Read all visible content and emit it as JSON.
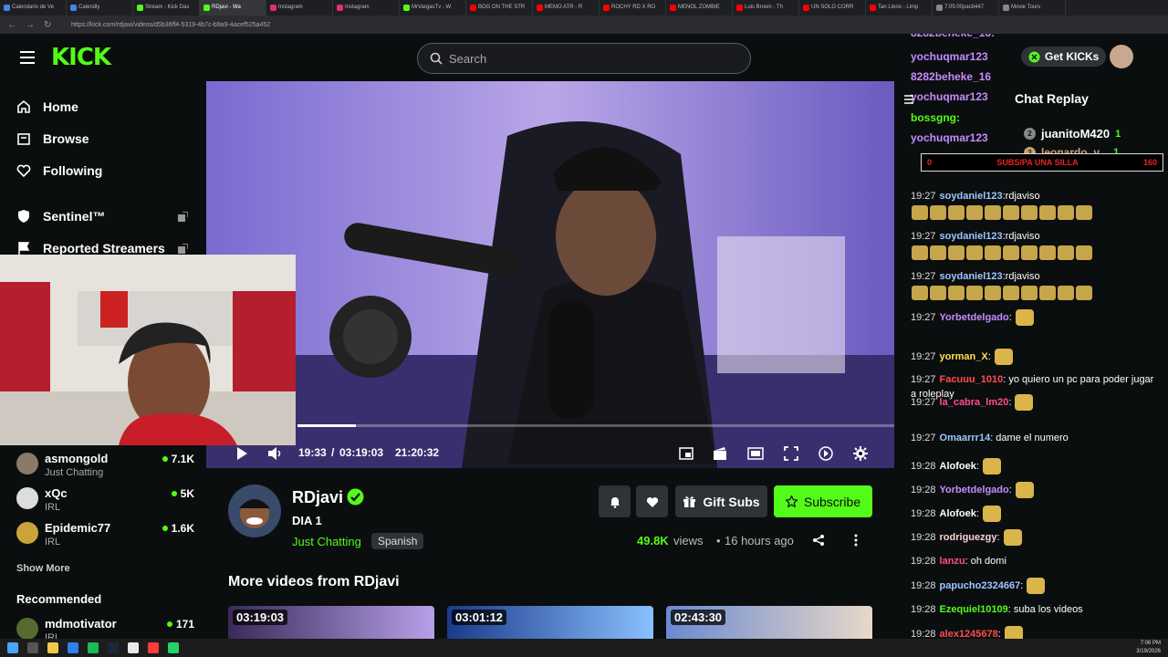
{
  "browser": {
    "tabs": [
      "Calendario de Ve",
      "Calendly",
      "Stream - Kick Das",
      "RDjavi - Wa",
      "Instagram",
      "Instagram",
      "MrVargasTv - W",
      "BOG ON THE STR",
      "MEMO ATR - R",
      "ROCHY RD X RO",
      "MENOL ZOMBIE",
      "Luis Brown - Th",
      "UN SOLO CORR",
      "Tan Lleno - Limp",
      "7:05:00pacb447",
      "Movie Tours"
    ],
    "url": "https://kick.com/rdjavi/videos/d5b36ff4-5319-4b7c-b9a9-4acef525a452"
  },
  "header": {
    "logo": "KICK",
    "search_placeholder": "Search"
  },
  "sidebar": {
    "nav": [
      {
        "label": "Home",
        "icon": "home-icon"
      },
      {
        "label": "Browse",
        "icon": "browse-icon"
      },
      {
        "label": "Following",
        "icon": "heart-icon"
      },
      {
        "label": "Sentinel™",
        "icon": "shield-icon"
      },
      {
        "label": "Reported Streamers",
        "icon": "flag-icon"
      }
    ],
    "streams": [
      {
        "name": "asmongold",
        "category": "Just Chatting",
        "viewers": "7.1K"
      },
      {
        "name": "xQc",
        "category": "IRL",
        "viewers": "5K"
      },
      {
        "name": "Epidemic77",
        "category": "IRL",
        "viewers": "1.6K"
      }
    ],
    "show_more": "Show More",
    "recommended_heading": "Recommended",
    "recommended": [
      {
        "name": "mdmotivator",
        "category": "IRL",
        "viewers": "171"
      }
    ]
  },
  "player": {
    "current_time": "19:33",
    "separator": "/",
    "duration": "03:19:03",
    "clock": "21:20:32",
    "progress": 0.098
  },
  "channel": {
    "name": "RDjavi",
    "title": "DIA 1",
    "category": "Just Chatting",
    "language": "Spanish",
    "views": "49.8K",
    "views_label": "views",
    "age": "16 hours ago",
    "gift_subs_label": "Gift Subs",
    "subscribe_label": "Subscribe"
  },
  "more_videos": {
    "heading": "More videos from RDjavi",
    "durations": [
      "03:19:03",
      "03:01:12",
      "02:43:30"
    ]
  },
  "chat": {
    "get_kicks": "Get KICKs",
    "replay_title": "Chat Replay",
    "top_users": [
      {
        "rank": "2",
        "name": "juanitoM420",
        "count": "1"
      },
      {
        "rank": "3",
        "name": "leonardo_v...",
        "count": "1"
      }
    ],
    "goal": {
      "start": "0",
      "label": "SUBS/PA UNA SILLA",
      "end": "160"
    },
    "overlay": [
      {
        "user": "8282beheke_16",
        "text": ":"
      },
      {
        "user": "8282beheke_16",
        "text": ":"
      },
      {
        "user": "yochuqmar123",
        "text": ":"
      },
      {
        "user": "8282beheke_16",
        "text": ":"
      },
      {
        "user": "yochuqmar123",
        "text": ":"
      },
      {
        "user": "bossgng",
        "text": ":"
      },
      {
        "user": "yochuqmar123",
        "text": ":"
      }
    ],
    "messages": [
      {
        "time": "19:27",
        "user": "soydaniel123",
        "color": "#9ec6ff",
        "text": ":rdjaviso"
      },
      {
        "time": "19:27",
        "user": "soydaniel123",
        "color": "#9ec6ff",
        "text": ":rdjaviso"
      },
      {
        "time": "19:27",
        "user": "soydaniel123",
        "color": "#9ec6ff",
        "text": ":rdjaviso"
      },
      {
        "time": "19:27",
        "user": "Yorbetdelgado",
        "color": "#c58cff",
        "text": ":"
      },
      {
        "time": "19:27",
        "user": "yorman_X",
        "color": "#ffe04d",
        "text": ":"
      },
      {
        "time": "19:27",
        "user": "Facuuu_1010",
        "color": "#ff4d4d",
        "text": ": yo quiero un pc para poder jugar a roleplay"
      },
      {
        "time": "19:27",
        "user": "la_cabra_lm20",
        "color": "#ff4d8c",
        "text": ":"
      },
      {
        "time": "19:27",
        "user": "Omaarrr14",
        "color": "#9ec6ff",
        "text": ": dame el numero"
      },
      {
        "time": "19:28",
        "user": "Alofoek",
        "color": "#ffffff",
        "text": ":"
      },
      {
        "time": "19:28",
        "user": "Yorbetdelgado",
        "color": "#c58cff",
        "text": ":"
      },
      {
        "time": "19:28",
        "user": "Alofoek",
        "color": "#ffffff",
        "text": ":"
      },
      {
        "time": "19:28",
        "user": "rodriguezgy",
        "color": "#ffd0d0",
        "text": ":"
      },
      {
        "time": "19:28",
        "user": "lanzu",
        "color": "#ff4d8c",
        "text": ": oh domi"
      },
      {
        "time": "19:28",
        "user": "papucho2324667",
        "color": "#9ec6ff",
        "text": ":"
      },
      {
        "time": "19:28",
        "user": "Ezequiel10109",
        "color": "#53fc18",
        "text": ": suba los videos"
      },
      {
        "time": "19:28",
        "user": "alex1245678",
        "color": "#ff4d4d",
        "text": ":"
      }
    ]
  },
  "taskbar": {
    "time": "7:06 PM",
    "date": "3/19/2026"
  },
  "colors": {
    "accent": "#53fc18",
    "background": "#0b0e0f"
  }
}
